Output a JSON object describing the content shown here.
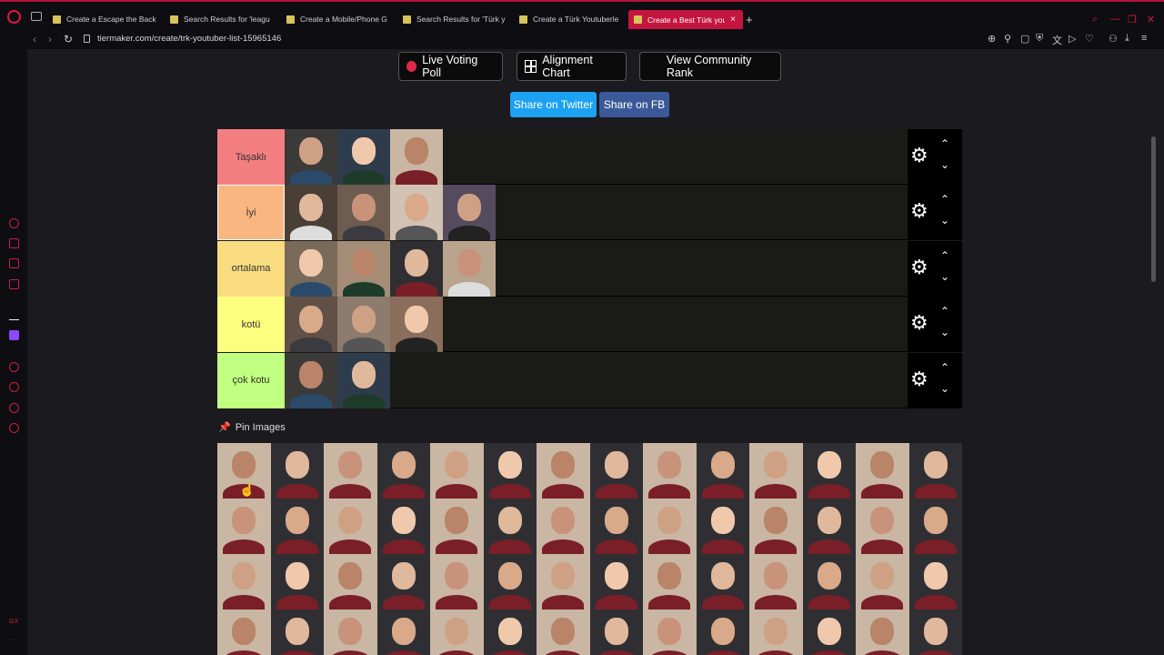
{
  "browser": {
    "tabs": [
      {
        "label": "Create a Escape the Back"
      },
      {
        "label": "Search Results for 'leagu"
      },
      {
        "label": "Create a Mobile/Phone G"
      },
      {
        "label": "Search Results for 'Türk y"
      },
      {
        "label": "Create a Türk Youtuberle"
      },
      {
        "label": "Create a Best Türk youtu",
        "active": true
      }
    ],
    "url": "tiermaker.com/create/trk-youtuber-list-15965146"
  },
  "toolbar": {
    "live_voting_poll": "Live Voting Poll",
    "alignment_chart": "Alignment Chart",
    "view_community_rank": "View Community Rank",
    "share_twitter": "Share on Twitter",
    "share_fb": "Share on FB"
  },
  "tiers": [
    {
      "label": "Taşaklı",
      "color": "#f47f80",
      "items": 3
    },
    {
      "label": "İyi",
      "color": "#f8b780",
      "items": 4,
      "selected": true
    },
    {
      "label": "ortalama",
      "color": "#fadc80",
      "items": 4
    },
    {
      "label": "kotü",
      "color": "#fdfd7f",
      "items": 3
    },
    {
      "label": "çok kotu",
      "color": "#c1ff80",
      "items": 2
    }
  ],
  "pin_images_label": "Pin Images",
  "colors": {
    "accent": "#c4153f",
    "twitter": "#1da1f2",
    "facebook": "#3b5998"
  }
}
